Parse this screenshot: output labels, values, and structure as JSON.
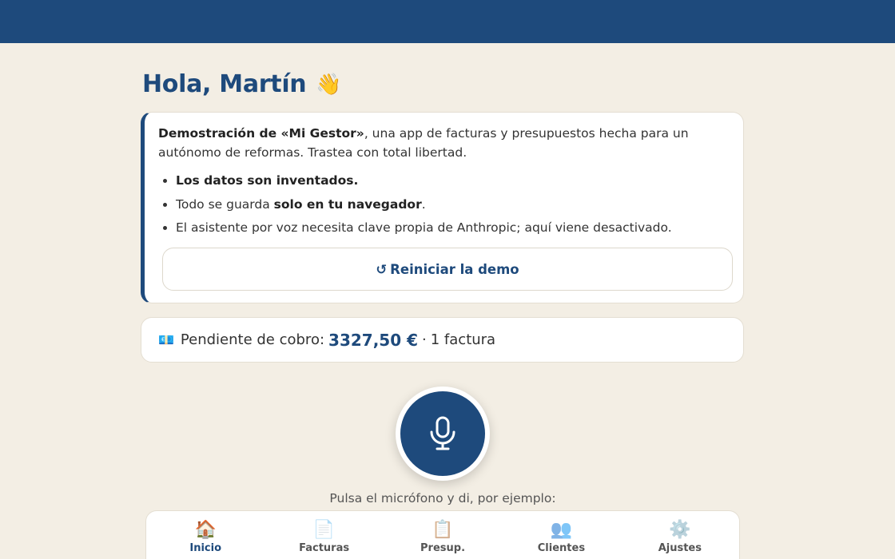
{
  "greeting": {
    "text": "Hola, Martín",
    "emoji": "👋"
  },
  "demo": {
    "intro_bold": "Demostración de «Mi Gestor»",
    "intro_rest": ", una app de facturas y presupuestos hecha para un autónomo de reformas. Trastea con total libertad.",
    "items": [
      {
        "bold": "Los datos son inventados.",
        "before": "",
        "after": ""
      },
      {
        "before": "Todo se guarda ",
        "bold": "solo en tu navegador",
        "after": "."
      },
      {
        "before": "El asistente por voz necesita clave propia de Anthropic; aquí viene desactivado.",
        "bold": "",
        "after": ""
      }
    ],
    "reset_icon": "↺",
    "reset_label": "Reiniciar la demo"
  },
  "pending": {
    "icon": "💶",
    "label": "Pendiente de cobro:",
    "amount": "3327,50 €",
    "separator": "·",
    "count": "1 factura"
  },
  "mic": {
    "icon": "microphone-icon"
  },
  "hint": "Pulsa el micrófono y di, por ejemplo:",
  "nav": [
    {
      "icon": "🏠",
      "label": "Inicio",
      "active": true
    },
    {
      "icon": "📄",
      "label": "Facturas",
      "active": false
    },
    {
      "icon": "📋",
      "label": "Presup.",
      "active": false
    },
    {
      "icon": "👥",
      "label": "Clientes",
      "active": false
    },
    {
      "icon": "⚙️",
      "label": "Ajustes",
      "active": false
    }
  ],
  "colors": {
    "primary": "#1e4a7c",
    "background": "#f3eee4"
  }
}
